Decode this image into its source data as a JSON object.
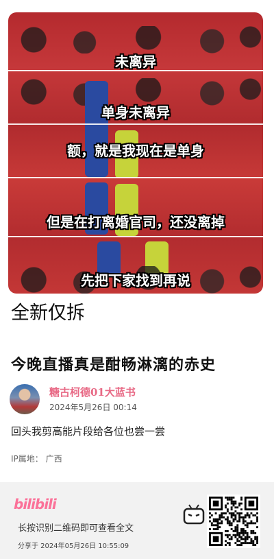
{
  "video": {
    "subtitles": [
      "未离异",
      "单身未离异",
      "额，就是我现在是单身",
      "但是在打离婚官司，还没离掉",
      "先把下家找到再说"
    ]
  },
  "caption": "全新仅拆",
  "post": {
    "title": "今晚直播真是酣畅淋漓的赤史",
    "author": "糖古柯德01大蓝书",
    "date": "2024年5月26日  00:14",
    "body": "回头我剪高能片段给各位也尝一尝",
    "ip": "IP属地： 广西"
  },
  "footer": {
    "logo": "bilibili",
    "hint": "长按识别二维码即可查看全文",
    "shared": "分享于 2024年05月26日 10:55:09"
  },
  "colors": {
    "accent": "#fb7299",
    "author": "#e86a86",
    "footer_bg": "#f2f2f2"
  }
}
